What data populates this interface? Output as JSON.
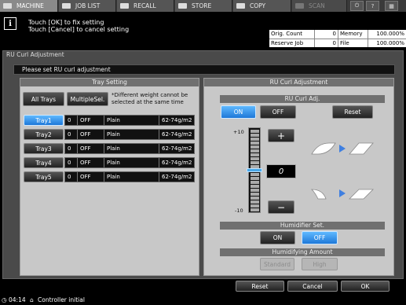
{
  "tabs": [
    {
      "label": "MACHINE",
      "icon": "machine-icon",
      "state": "active"
    },
    {
      "label": "JOB LIST",
      "icon": "job-list-icon",
      "state": "normal"
    },
    {
      "label": "RECALL",
      "icon": "recall-icon",
      "state": "normal"
    },
    {
      "label": "STORE",
      "icon": "store-icon",
      "state": "normal"
    },
    {
      "label": "COPY",
      "icon": "copy-icon",
      "state": "normal"
    },
    {
      "label": "SCAN",
      "icon": "scan-icon",
      "state": "disabled"
    }
  ],
  "topright": {
    "power_icon": "power-icon",
    "help_label": "?"
  },
  "message": {
    "line1": "Touch [OK] to fix setting",
    "line2": "Touch [Cancel] to cancel setting",
    "icon": "info-icon"
  },
  "counters": {
    "orig_count_label": "Orig. Count",
    "orig_count": "0",
    "memory_label": "Memory",
    "memory": "100.000%",
    "reserve_job_label": "Reserve Job",
    "reserve_job": "0",
    "file_amount_label": "File Amount",
    "file_amount": "100.000%"
  },
  "screen_title": "RU Curl Adjustment",
  "instruction": "Please set RU curl adjustment",
  "tray_setting": {
    "header": "Tray Setting",
    "all_trays": "All Trays",
    "multiple_sel": "MultipleSel.",
    "note": "*Different weight cannot be selected at the same time",
    "rows": [
      {
        "tray": "Tray1",
        "value": "0",
        "mode": "OFF",
        "paper": "Plain",
        "weight": "62-74g/m2",
        "selected": true
      },
      {
        "tray": "Tray2",
        "value": "0",
        "mode": "OFF",
        "paper": "Plain",
        "weight": "62-74g/m2",
        "selected": false
      },
      {
        "tray": "Tray3",
        "value": "0",
        "mode": "OFF",
        "paper": "Plain",
        "weight": "62-74g/m2",
        "selected": false
      },
      {
        "tray": "Tray4",
        "value": "0",
        "mode": "OFF",
        "paper": "Plain",
        "weight": "62-74g/m2",
        "selected": false
      },
      {
        "tray": "Tray5",
        "value": "0",
        "mode": "OFF",
        "paper": "Plain",
        "weight": "62-74g/m2",
        "selected": false
      }
    ]
  },
  "ru_adjust": {
    "header": "RU Curl Adjustment",
    "sub_header": "RU Curl Adj.",
    "on_label": "ON",
    "off_label": "OFF",
    "reset_label": "Reset",
    "on_selected": true,
    "scale_max": "+10",
    "scale_min": "-10",
    "value": "0",
    "plus_label": "+",
    "minus_label": "−"
  },
  "humidifier": {
    "header": "Humidifier Set.",
    "on_label": "ON",
    "off_label": "OFF",
    "off_selected": true,
    "amount_header": "Humidifying Amount",
    "standard_label": "Standard",
    "high_label": "High"
  },
  "bottom": {
    "reset": "Reset",
    "cancel": "Cancel",
    "ok": "OK"
  },
  "status": {
    "time": "04:14",
    "message": "Controller initial"
  },
  "colors": {
    "selected": "#1e78d8",
    "panel": "#c8c8c8",
    "background": "#4a4a4a"
  }
}
